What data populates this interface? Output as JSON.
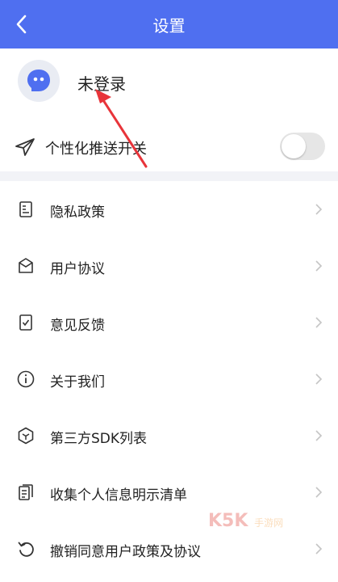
{
  "header": {
    "title": "设置",
    "back_icon": "chevron-left-icon"
  },
  "user": {
    "login_status": "未登录",
    "avatar_icon": "robot-avatar-icon"
  },
  "push": {
    "label": "个性化推送开关",
    "enabled": false,
    "icon": "paper-plane-icon"
  },
  "menu": {
    "items": [
      {
        "label": "隐私政策",
        "icon": "privacy-doc-icon"
      },
      {
        "label": "用户协议",
        "icon": "agreement-icon"
      },
      {
        "label": "意见反馈",
        "icon": "feedback-icon"
      },
      {
        "label": "关于我们",
        "icon": "info-icon"
      },
      {
        "label": "第三方SDK列表",
        "icon": "hexagon-icon"
      },
      {
        "label": "收集个人信息明示清单",
        "icon": "list-doc-icon"
      },
      {
        "label": "撤销同意用户政策及协议",
        "icon": "revoke-icon"
      }
    ]
  },
  "watermark": {
    "brand": "K5K",
    "tagline": "手游网"
  },
  "colors": {
    "header": "#4f6ff0",
    "arrow": "#e8343a",
    "page_bg": "#f2f3f7"
  }
}
